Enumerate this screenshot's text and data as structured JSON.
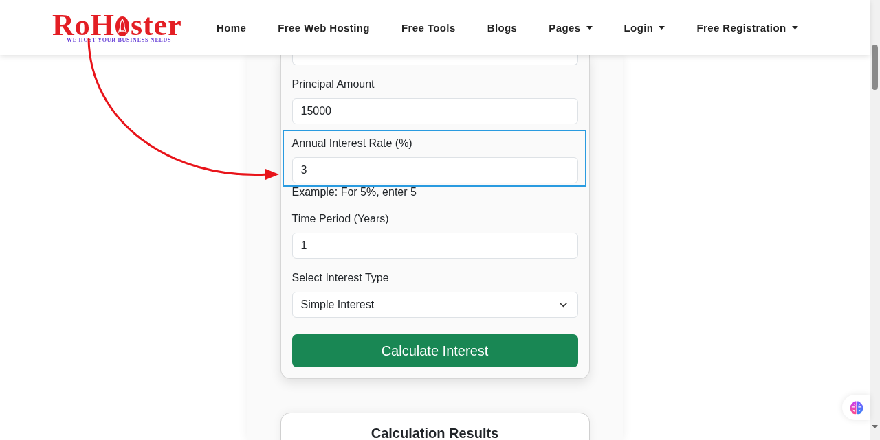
{
  "header": {
    "logo": {
      "text_start": "RoH",
      "text_end": "ster",
      "tagline": "WE HOST YOUR BUSINESS NEEDS"
    },
    "nav": [
      {
        "label": "Home",
        "dropdown": false
      },
      {
        "label": "Free Web Hosting",
        "dropdown": false
      },
      {
        "label": "Free Tools",
        "dropdown": false
      },
      {
        "label": "Blogs",
        "dropdown": false
      },
      {
        "label": "Pages",
        "dropdown": true
      },
      {
        "label": "Login",
        "dropdown": true
      },
      {
        "label": "Free Registration",
        "dropdown": true
      }
    ]
  },
  "calculator": {
    "fields": [
      {
        "kind": "cut-off",
        "highlighted": false
      },
      {
        "kind": "input",
        "label": "Principal Amount",
        "value": "15000",
        "highlighted": false
      },
      {
        "kind": "input",
        "label": "Annual Interest Rate (%)",
        "value": "3",
        "hint": "Example: For 5%, enter 5",
        "highlighted": true
      },
      {
        "kind": "input",
        "label": "Time Period (Years)",
        "value": "1",
        "highlighted": false
      },
      {
        "kind": "select",
        "label": "Select Interest Type",
        "value": "Simple Interest",
        "highlighted": false
      }
    ],
    "button": "Calculate Interest"
  },
  "results": {
    "title": "Calculation Results"
  }
}
